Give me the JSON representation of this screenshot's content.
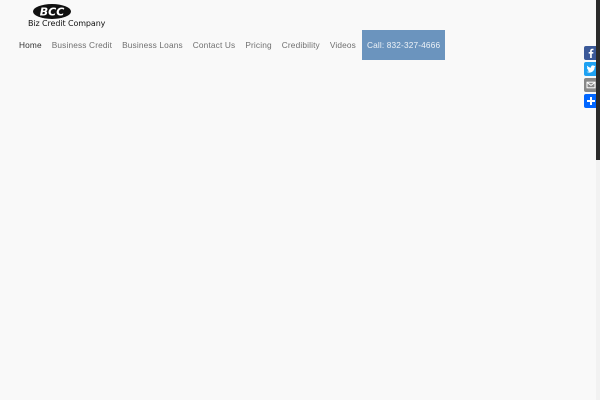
{
  "logo": {
    "monogram": "BCC",
    "company_name": "Biz Credit Company"
  },
  "nav": {
    "items": [
      {
        "label": "Home",
        "active": true
      },
      {
        "label": "Business Credit",
        "active": false
      },
      {
        "label": "Business Loans",
        "active": false
      },
      {
        "label": "Contact Us",
        "active": false
      },
      {
        "label": "Pricing",
        "active": false
      },
      {
        "label": "Credibility",
        "active": false
      },
      {
        "label": "Videos",
        "active": false
      }
    ],
    "call_label": "Call: 832-327-4666"
  },
  "share": {
    "buttons": [
      {
        "name": "facebook-icon",
        "color": "#3b5998"
      },
      {
        "name": "twitter-icon",
        "color": "#1da1f2"
      },
      {
        "name": "email-icon",
        "color": "#888888"
      },
      {
        "name": "share-plus-icon",
        "color": "#0166ff"
      }
    ]
  },
  "colors": {
    "background": "#f9f9f9",
    "call_button": "#6b94be"
  }
}
